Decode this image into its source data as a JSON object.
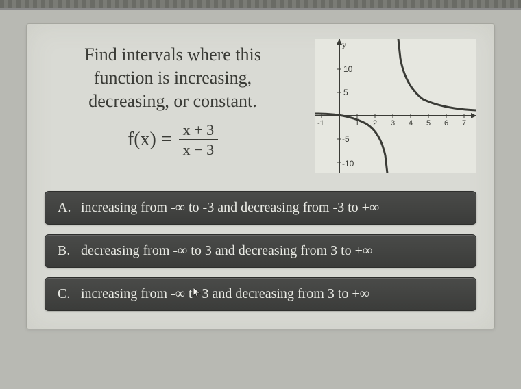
{
  "question": {
    "line1": "Find intervals where this",
    "line2": "function is increasing,",
    "line3": "decreasing, or constant.",
    "fx_lhs": "f(x) =",
    "frac_num": "x + 3",
    "frac_den": "x − 3"
  },
  "graph": {
    "y_label": "y",
    "y_ticks": [
      "10",
      "5",
      "-5",
      "-10"
    ],
    "x_ticks": [
      "-1",
      "1",
      "2",
      "3",
      "4",
      "5",
      "6",
      "7"
    ],
    "asymptote_x": 3,
    "type": "rational-hyperbola"
  },
  "options": {
    "a": {
      "letter": "A.",
      "text_before": "increasing from -∞ to -3 and decreasing from -3 to +∞",
      "has_cursor": false
    },
    "b": {
      "letter": "B.",
      "text_before": "decreasing from -∞ to 3 and decreasing from 3 to +∞",
      "has_cursor": false
    },
    "c": {
      "letter": "C.",
      "pre": "increasing from -∞ t",
      "post": "3 and decreasing from 3 to +∞",
      "has_cursor": true
    }
  }
}
